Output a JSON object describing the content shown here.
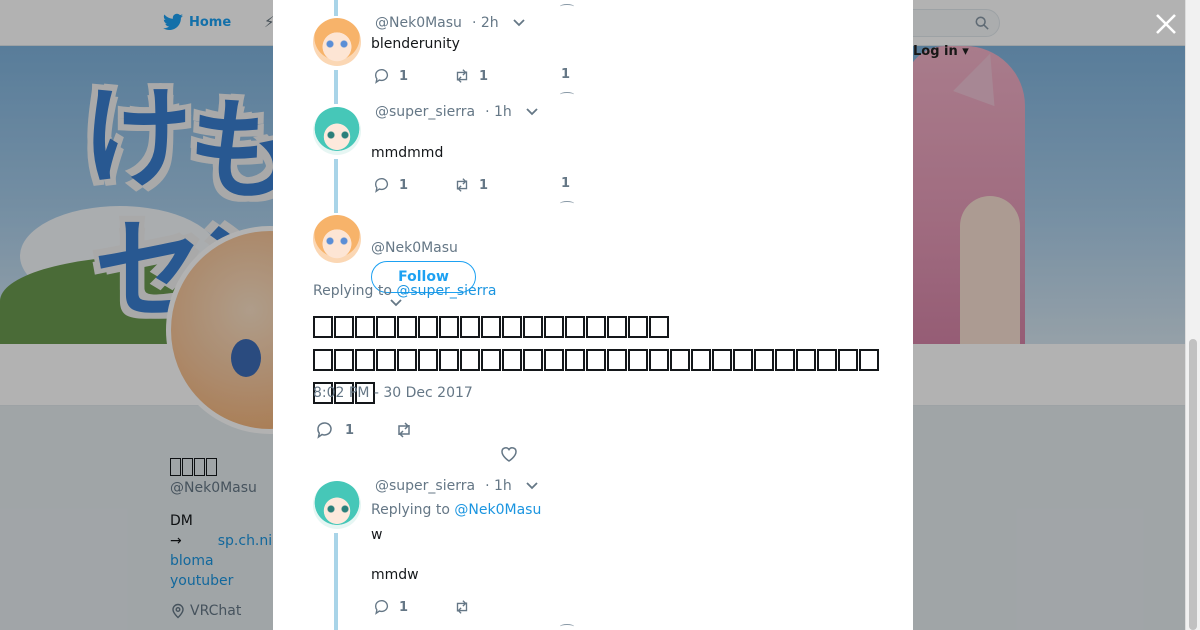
{
  "background": {
    "nav": {
      "home_label": "Home",
      "login_label": "Log in"
    },
    "profile": {
      "display_name_glyph_count": 4,
      "handle": "@Nek0Masu",
      "bio_line1": "DM",
      "bio_arrow": "→",
      "bio_link1": "sp.ch.ni",
      "bio_link2": "bloma",
      "bio_link3": "youtuber",
      "location": "VRChat"
    }
  },
  "thread": [
    {
      "handle": "@Nek0Masu",
      "time": "· 2h",
      "text": "blenderunity",
      "replies": "1",
      "retweets": "1",
      "likes": "1"
    },
    {
      "handle": "@super_sierra",
      "time": "· 1h",
      "text": "mmdmmd",
      "replies": "1",
      "retweets": "1",
      "likes": "1"
    }
  ],
  "main_tweet": {
    "handle": "@Nek0Masu",
    "follow_label": "Follow",
    "replying_prefix": "Replying to",
    "replying_to": "@super_sierra",
    "line1_glyph_count": 17,
    "line2_glyph_count": 30,
    "timestamp": "8:02 PM - 30 Dec 2017",
    "replies": "1"
  },
  "reply": {
    "handle": "@super_sierra",
    "time": "· 1h",
    "replying_prefix": "Replying to",
    "replying_to": "@Nek0Masu",
    "line1": "w",
    "line2": "mmdw",
    "replies": "1"
  },
  "colors": {
    "accent": "#1da1f2",
    "link": "#1b95e0",
    "thread_line": "#a9d4e8",
    "muted": "#657786"
  }
}
